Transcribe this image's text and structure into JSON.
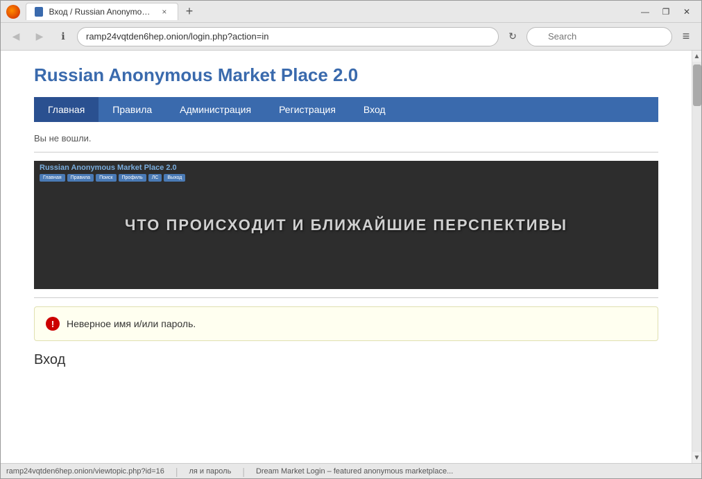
{
  "browser": {
    "title": "Вход / Russian Anonymous M...",
    "tab_close": "×",
    "new_tab": "+",
    "minimize": "—",
    "restore": "❐",
    "close": "✕",
    "back_icon": "◀",
    "forward_icon": "▶",
    "info_icon": "ℹ",
    "refresh_icon": "↻",
    "address": "ramp24vqtden6hep.onion/login.php?action=in",
    "search_placeholder": "Search",
    "menu_icon": "≡"
  },
  "nav_menu": {
    "items": [
      {
        "label": "Главная",
        "active": true
      },
      {
        "label": "Правила",
        "active": false
      },
      {
        "label": "Администрация",
        "active": false
      },
      {
        "label": "Регистрация",
        "active": false
      },
      {
        "label": "Вход",
        "active": false
      }
    ]
  },
  "page": {
    "site_title": "Russian Anonymous Market Place 2.0",
    "logged_out_msg": "Вы не вошли.",
    "announcement": {
      "fake_site_title": "Russian Anonymous Market Place 2.0",
      "fake_nav": [
        "Главная",
        "Правила",
        "Поиск",
        "Профиль",
        "ЛС",
        "Выход"
      ],
      "overlay_text": "ЧТО ПРОИСХОДИТ И БЛИЖАЙШИЕ ПЕРСПЕКТИВЫ"
    },
    "error": {
      "icon": "!",
      "message": "Неверное имя и/или пароль."
    },
    "login_heading": "Вход"
  },
  "status_bar": {
    "url": "ramp24vqtden6hep.onion/viewtopic.php?id=16",
    "text1": "ля и пароль",
    "separator": "|",
    "text2": "Dream Market Login – featured anonymous marketplace..."
  }
}
